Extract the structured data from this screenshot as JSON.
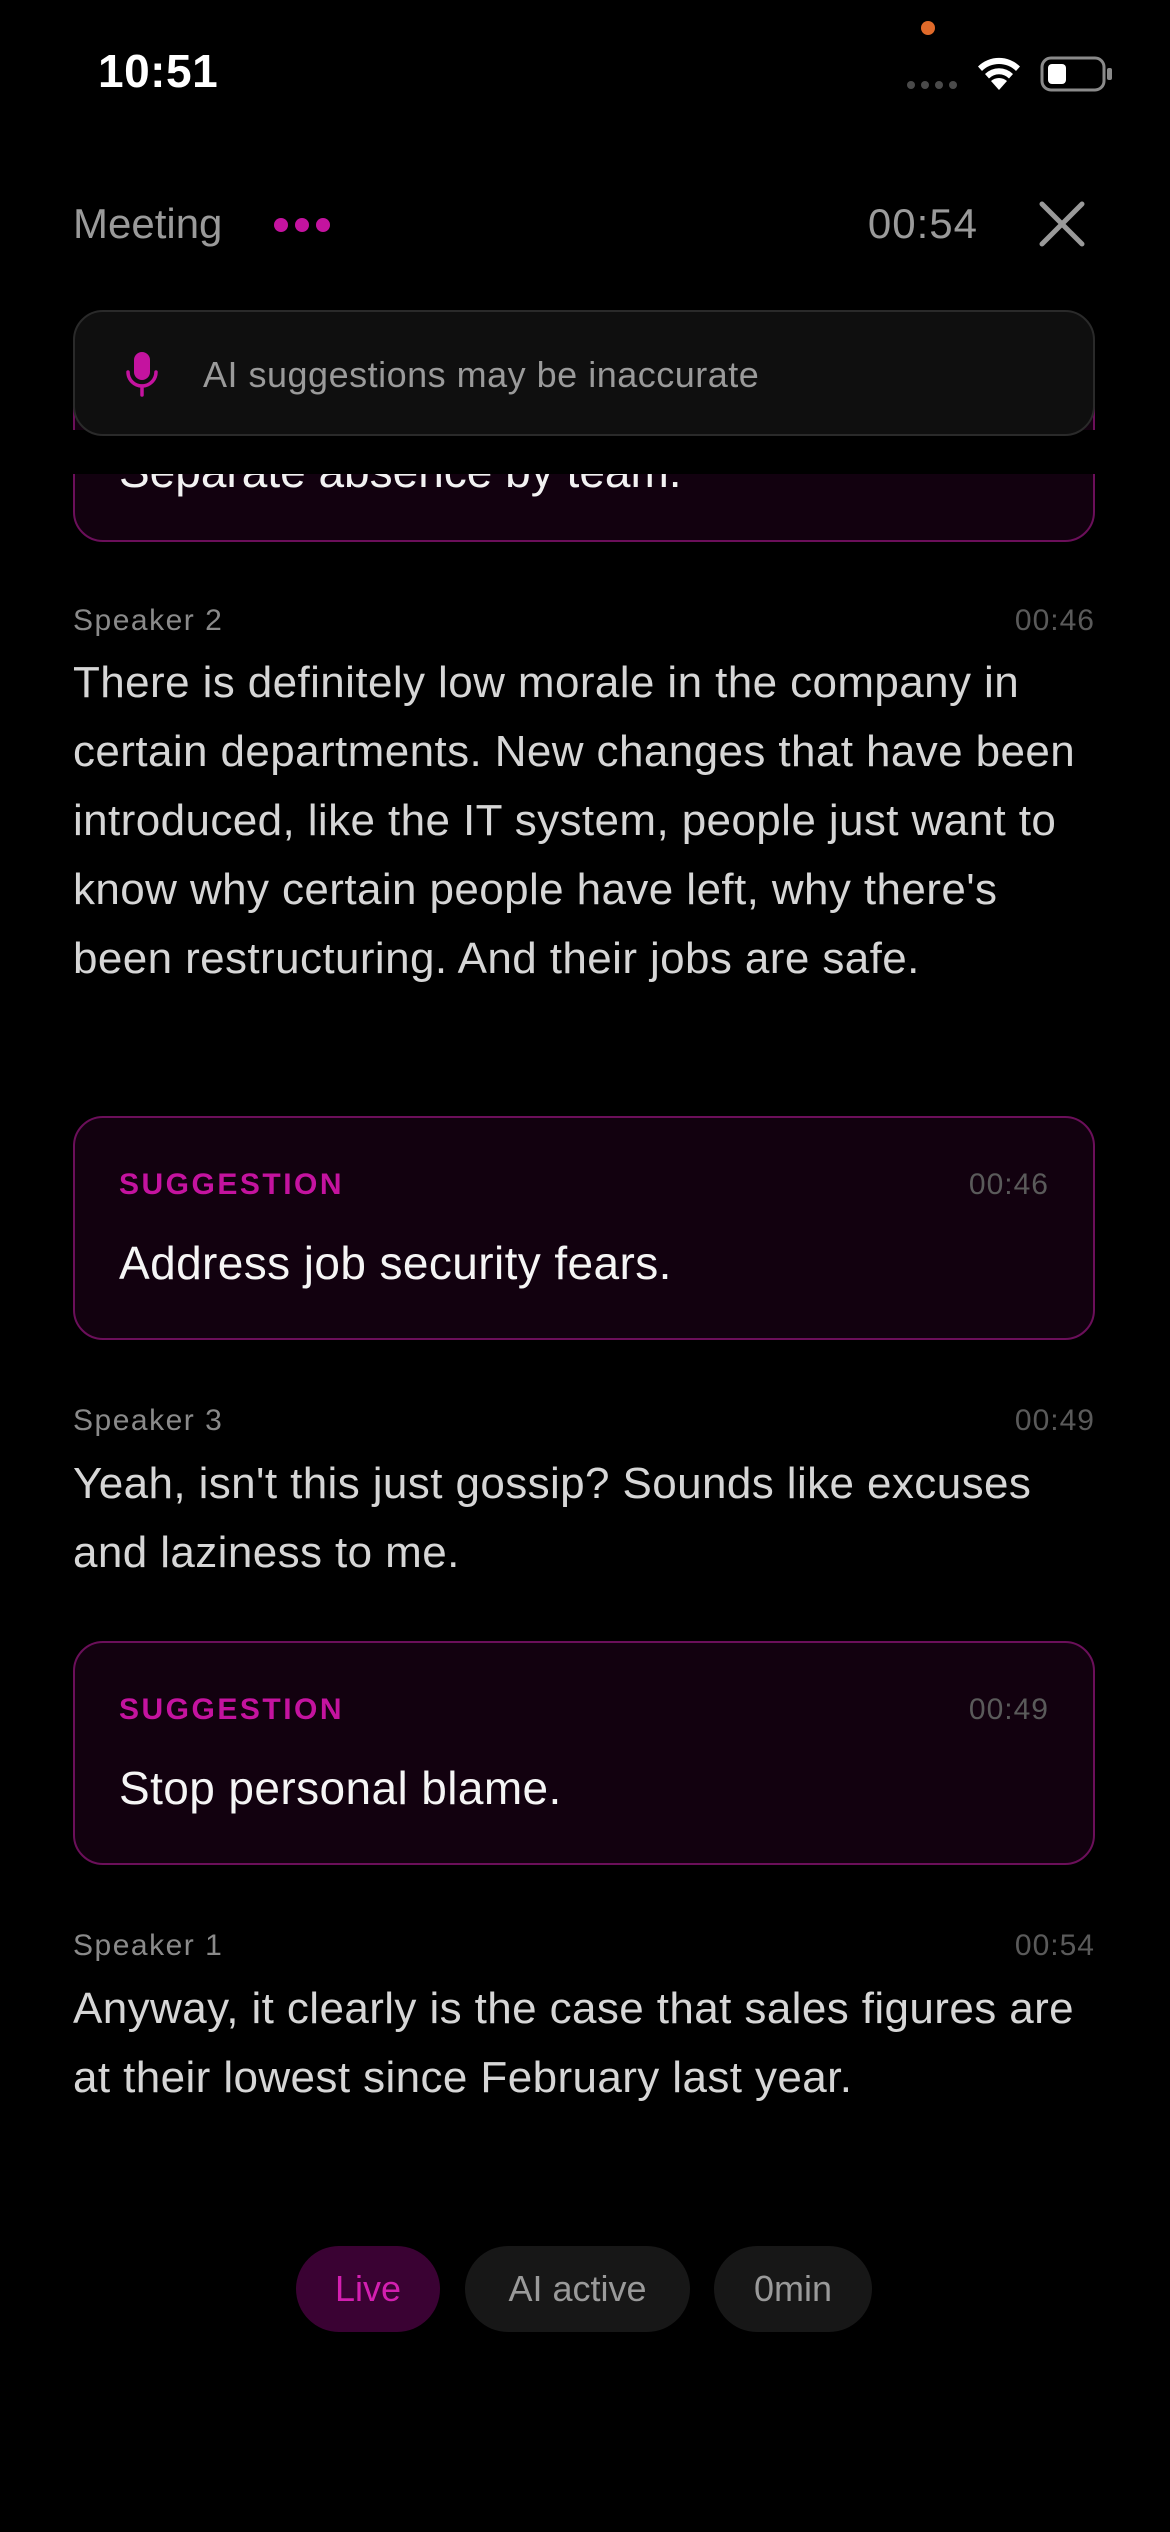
{
  "status_bar": {
    "time": "10:51",
    "privacy_dot_color": "#e06a2a"
  },
  "header": {
    "title": "Meeting",
    "timer": "00:54",
    "accent_color": "#c4139f"
  },
  "banner": {
    "text": "AI suggestions may be inaccurate"
  },
  "previous_card": {
    "text": "Separate absence by team."
  },
  "transcript": [
    {
      "speaker": "Speaker 2",
      "time": "00:46",
      "text": "There is definitely low morale in the company in certain departments. New changes that have been introduced, like the IT system, people just want to know why certain people have left, why there's been restructuring. And their jobs are safe."
    },
    {
      "speaker": "Speaker 3",
      "time": "00:49",
      "text": "Yeah, isn't this just gossip? Sounds like excuses and laziness to me."
    },
    {
      "speaker": "Speaker 1",
      "time": "00:54",
      "text": "Anyway, it clearly is the case that sales figures are at their lowest since February last year."
    }
  ],
  "suggestions": [
    {
      "label": "SUGGESTION",
      "time": "00:46",
      "text": "Address job security fears."
    },
    {
      "label": "SUGGESTION",
      "time": "00:49",
      "text": "Stop personal blame."
    }
  ],
  "footer": {
    "live_label": "Live",
    "ai_label": "AI active",
    "duration_label": "0min"
  }
}
